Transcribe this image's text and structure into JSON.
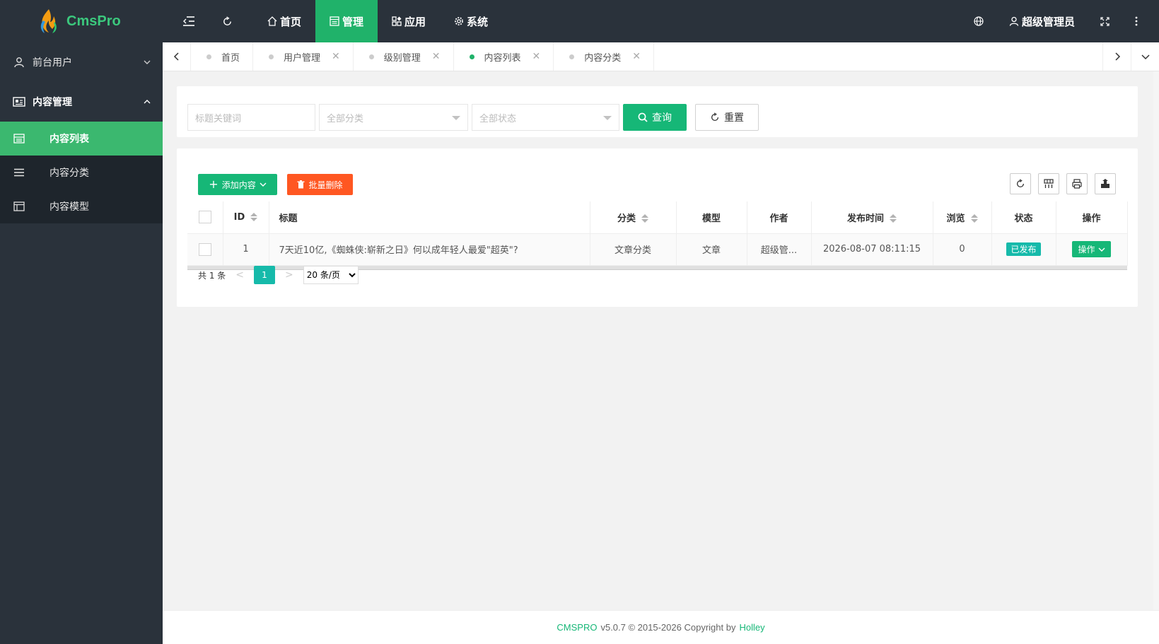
{
  "app": {
    "logo_text": "CmsPro"
  },
  "sidebar": {
    "groups": [
      {
        "label": "前台用户",
        "open": false
      },
      {
        "label": "内容管理",
        "open": true
      }
    ],
    "sub_items": [
      {
        "label": "内容列表",
        "active": true
      },
      {
        "label": "内容分类",
        "active": false
      },
      {
        "label": "内容模型",
        "active": false
      }
    ]
  },
  "topnav": {
    "items": [
      {
        "label": "首页",
        "icon": "home-icon"
      },
      {
        "label": "管理",
        "icon": "manage-icon",
        "active": true
      },
      {
        "label": "应用",
        "icon": "apps-icon"
      },
      {
        "label": "系统",
        "icon": "gear-icon"
      }
    ],
    "user_label": "超级管理员"
  },
  "tabs": [
    {
      "label": "首页",
      "closable": false
    },
    {
      "label": "用户管理",
      "closable": true
    },
    {
      "label": "级别管理",
      "closable": true
    },
    {
      "label": "内容列表",
      "closable": true,
      "active": true
    },
    {
      "label": "内容分类",
      "closable": true
    }
  ],
  "search": {
    "keyword_placeholder": "标题关键词",
    "category_placeholder": "全部分类",
    "status_placeholder": "全部状态",
    "query_label": "查询",
    "reset_label": "重置"
  },
  "toolbar": {
    "add_label": "添加内容",
    "batch_delete_label": "批量删除"
  },
  "table": {
    "columns": [
      "ID",
      "标题",
      "分类",
      "模型",
      "作者",
      "发布时间",
      "浏览",
      "状态",
      "操作"
    ],
    "rows": [
      {
        "id": "1",
        "title": "7天近10亿,《蜘蛛侠:崭新之日》何以成年轻人最爱\"超英\"?",
        "category": "文章分类",
        "model": "文章",
        "author": "超级管...",
        "publish_time": "2026-08-07 08:11:15",
        "views": "0",
        "status": "已发布",
        "action": "操作"
      }
    ]
  },
  "pager": {
    "total_text": "共 1 条",
    "current_page": "1",
    "page_size_option": "20 条/页"
  },
  "footer": {
    "brand": "CMSPRO",
    "version_text": "v5.0.7 © 2015-2026 Copyright by",
    "author": "Holley"
  },
  "colors": {
    "primary": "#16b777",
    "danger": "#ff5722",
    "sidebar_bg": "#2a323b",
    "badge": "#16baaa"
  }
}
